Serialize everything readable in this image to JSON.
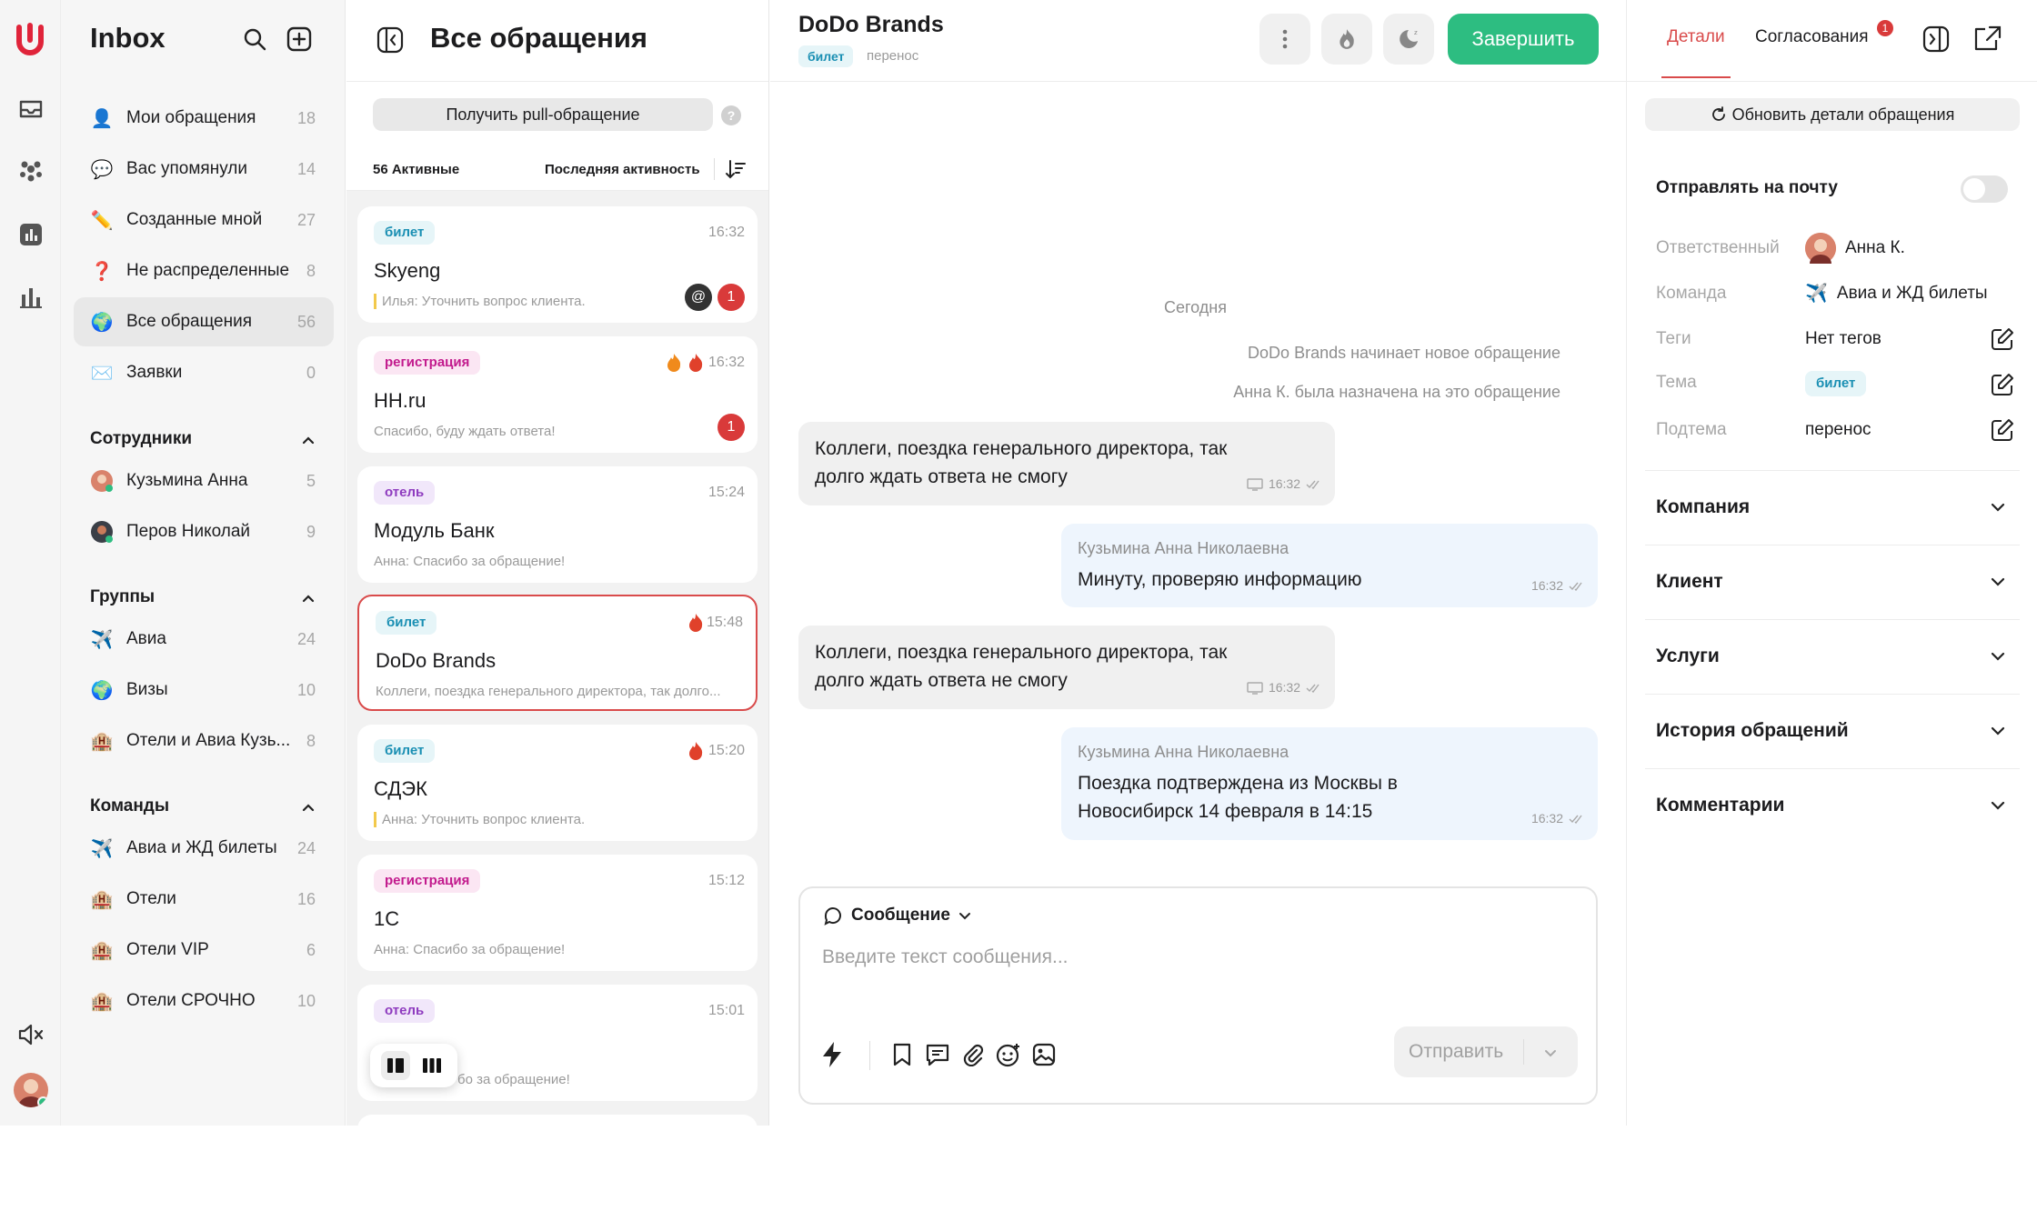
{
  "rail": {
    "icons": [
      "logo-icon",
      "inbox-icon",
      "team-icon",
      "reports-icon",
      "analytics-icon",
      "mute-icon"
    ]
  },
  "sidebar": {
    "title": "Inbox",
    "items": [
      {
        "label": "Мои обращения",
        "count": "18",
        "icon": "👤"
      },
      {
        "label": "Вас упомянули",
        "count": "14",
        "icon": "💬"
      },
      {
        "label": "Созданные мной",
        "count": "27",
        "icon": "✏️"
      },
      {
        "label": "Не распределенные",
        "count": "8",
        "icon": "❓"
      },
      {
        "label": "Все обращения",
        "count": "56",
        "icon": "🌍"
      },
      {
        "label": "Заявки",
        "count": "0",
        "icon": "✉️"
      }
    ],
    "employees_title": "Сотрудники",
    "employees": [
      {
        "label": "Кузьмина Анна",
        "count": "5"
      },
      {
        "label": "Перов Николай",
        "count": "9"
      }
    ],
    "groups_title": "Группы",
    "groups": [
      {
        "label": "Авиа",
        "count": "24",
        "icon": "✈️"
      },
      {
        "label": "Визы",
        "count": "10",
        "icon": "🌍"
      },
      {
        "label": "Отели и Авиа Кузь...",
        "count": "8",
        "icon": "🏨"
      }
    ],
    "teams_title": "Команды",
    "teams": [
      {
        "label": "Авиа и ЖД билеты",
        "count": "24",
        "icon": "✈️"
      },
      {
        "label": "Отели",
        "count": "16",
        "icon": "🏨"
      },
      {
        "label": "Отели VIP",
        "count": "6",
        "icon": "🏨"
      },
      {
        "label": "Отели СРОЧНО",
        "count": "10",
        "icon": "🏨"
      }
    ]
  },
  "list": {
    "title": "Все обращения",
    "pull_button": "Получить pull-обращение",
    "help": "?",
    "active_count": "56 Активные",
    "sort_label": "Последняя активность",
    "cards": [
      {
        "tag": "билет",
        "tag_type": "bilet",
        "time": "16:32",
        "name": "Skyeng",
        "preview": "Илья: Уточнить вопрос клиента.",
        "mention": "@",
        "unread": "1"
      },
      {
        "tag": "регистрация",
        "tag_type": "reg",
        "time": "16:32",
        "name": "HH.ru",
        "preview": "Спасибо, буду ждать ответа!",
        "unread": "1"
      },
      {
        "tag": "отель",
        "tag_type": "hotel",
        "time": "15:24",
        "name": "Модуль Банк",
        "preview": "Анна: Спасибо за обращение!"
      },
      {
        "tag": "билет",
        "tag_type": "bilet",
        "time": "15:48",
        "name": "DoDo Brands",
        "preview": "Коллеги, поездка генерального директора, так долго..."
      },
      {
        "tag": "билет",
        "tag_type": "bilet",
        "time": "15:20",
        "name": "СДЭК",
        "preview": "Анна: Уточнить вопрос клиента."
      },
      {
        "tag": "регистрация",
        "tag_type": "reg",
        "time": "15:12",
        "name": "1С",
        "preview": "Анна: Спасибо за обращение!"
      },
      {
        "tag": "отель",
        "tag_type": "hotel",
        "time": "15:01",
        "name": "",
        "preview": "бо за обращение!"
      }
    ]
  },
  "chat": {
    "title": "DoDo Brands",
    "tag": "билет",
    "subtopic": "перенос",
    "finish_button": "Завершить",
    "day_label": "Сегодня",
    "system": [
      "DoDo Brands начинает новое обращение",
      "Анна К. была назначена на это обращение"
    ],
    "messages": [
      {
        "text1": "Коллеги, поездка генерального директора, так",
        "text2": "долго ждать ответа не смогу",
        "time": "16:32"
      },
      {
        "author": "Кузьмина Анна Николаевна",
        "text1": "Минуту, проверяю информацию",
        "time": "16:32"
      },
      {
        "text1": "Коллеги, поездка генерального директора, так",
        "text2": "долго ждать ответа не смогу",
        "time": "16:32"
      },
      {
        "author": "Кузьмина Анна Николаевна",
        "text1": "Поездка подтверждена из Москвы в",
        "text2": "Новосибирск 14 февраля в 14:15",
        "time": "16:32"
      }
    ],
    "composer": {
      "mode": "Сообщение",
      "placeholder": "Введите текст сообщения...",
      "send": "Отправить"
    }
  },
  "details": {
    "tab_details": "Детали",
    "tab_approvals": "Согласования",
    "approvals_badge": "1",
    "refresh": "Обновить детали обращения",
    "email_label": "Отправлять на почту",
    "email_enabled": false,
    "rows": {
      "assignee_label": "Ответственный",
      "assignee_value": "Анна К.",
      "team_label": "Команда",
      "team_value": "Авиа и ЖД билеты",
      "tags_label": "Теги",
      "tags_value": "Нет тегов",
      "topic_label": "Тема",
      "topic_value": "билет",
      "subtopic_label": "Подтема",
      "subtopic_value": "перенос"
    },
    "sections": [
      "Компания",
      "Клиент",
      "Услуги",
      "История обращений",
      "Комментарии"
    ]
  },
  "colors": {
    "accent": "#d94b4b",
    "success": "#2dbd81",
    "tag_bilet": "#1a8fb3",
    "tag_reg": "#c21a8d",
    "tag_hotel": "#8e3bbf"
  }
}
